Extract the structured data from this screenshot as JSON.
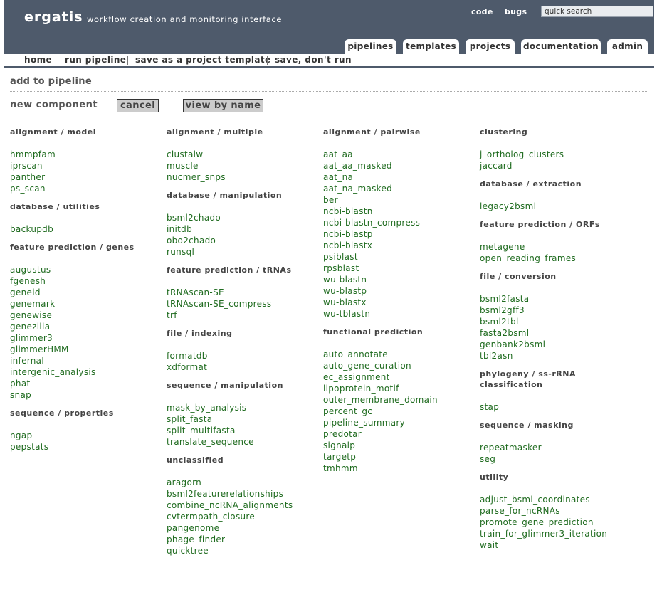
{
  "app": {
    "name": "ergatis",
    "tagline": "workflow creation and monitoring interface"
  },
  "top_links": [
    "code",
    "bugs"
  ],
  "search": {
    "value": "quick search"
  },
  "tabs": [
    "pipelines",
    "templates",
    "projects",
    "documentation",
    "admin"
  ],
  "active_tab": "pipelines",
  "subnav": [
    "home",
    "run pipeline",
    "save as a project template",
    "save, don't run"
  ],
  "page_title": "add to pipeline",
  "new_component": {
    "label": "new component",
    "cancel": "cancel",
    "view_by_name": "view by name"
  },
  "columns": [
    [
      {
        "title": "alignment / model",
        "items": [
          "hmmpfam",
          "iprscan",
          "panther",
          "ps_scan"
        ]
      },
      {
        "title": "database / utilities",
        "items": [
          "backupdb"
        ]
      },
      {
        "title": "feature prediction / genes",
        "items": [
          "augustus",
          "fgenesh",
          "geneid",
          "genemark",
          "genewise",
          "genezilla",
          "glimmer3",
          "glimmerHMM",
          "infernal",
          "intergenic_analysis",
          "phat",
          "snap"
        ]
      },
      {
        "title": "sequence / properties",
        "items": [
          "ngap",
          "pepstats"
        ]
      }
    ],
    [
      {
        "title": "alignment / multiple",
        "items": [
          "clustalw",
          "muscle",
          "nucmer_snps"
        ]
      },
      {
        "title": "database / manipulation",
        "items": [
          "bsml2chado",
          "initdb",
          "obo2chado",
          "runsql"
        ]
      },
      {
        "title": "feature prediction / tRNAs",
        "items": [
          "tRNAscan-SE",
          "tRNAscan-SE_compress",
          "trf"
        ]
      },
      {
        "title": "file / indexing",
        "items": [
          "formatdb",
          "xdformat"
        ]
      },
      {
        "title": "sequence / manipulation",
        "items": [
          "mask_by_analysis",
          "split_fasta",
          "split_multifasta",
          "translate_sequence"
        ]
      },
      {
        "title": "unclassified",
        "items": [
          "aragorn",
          "bsml2featurerelationships",
          "combine_ncRNA_alignments",
          "cvtermpath_closure",
          "pangenome",
          "phage_finder",
          "quicktree"
        ]
      }
    ],
    [
      {
        "title": "alignment / pairwise",
        "items": [
          "aat_aa",
          "aat_aa_masked",
          "aat_na",
          "aat_na_masked",
          "ber",
          "ncbi-blastn",
          "ncbi-blastn_compress",
          "ncbi-blastp",
          "ncbi-blastx",
          "psiblast",
          "rpsblast",
          "wu-blastn",
          "wu-blastp",
          "wu-blastx",
          "wu-tblastn"
        ]
      },
      {
        "title": "functional prediction",
        "items": [
          "auto_annotate",
          "auto_gene_curation",
          "ec_assignment",
          "lipoprotein_motif",
          "outer_membrane_domain",
          "percent_gc",
          "pipeline_summary",
          "predotar",
          "signalp",
          "targetp",
          "tmhmm"
        ]
      }
    ],
    [
      {
        "title": "clustering",
        "items": [
          "j_ortholog_clusters",
          "jaccard"
        ]
      },
      {
        "title": "database / extraction",
        "items": [
          "legacy2bsml"
        ]
      },
      {
        "title": "feature prediction / ORFs",
        "items": [
          "metagene",
          "open_reading_frames"
        ]
      },
      {
        "title": "file / conversion",
        "items": [
          "bsml2fasta",
          "bsml2gff3",
          "bsml2tbl",
          "fasta2bsml",
          "genbank2bsml",
          "tbl2asn"
        ]
      },
      {
        "title": "phylogeny / ss-rRNA classification",
        "items": [
          "stap"
        ]
      },
      {
        "title": "sequence / masking",
        "items": [
          "repeatmasker",
          "seg"
        ]
      },
      {
        "title": "utility",
        "items": [
          "adjust_bsml_coordinates",
          "parse_for_ncRNAs",
          "promote_gene_prediction",
          "train_for_glimmer3_iteration",
          "wait"
        ]
      }
    ]
  ]
}
